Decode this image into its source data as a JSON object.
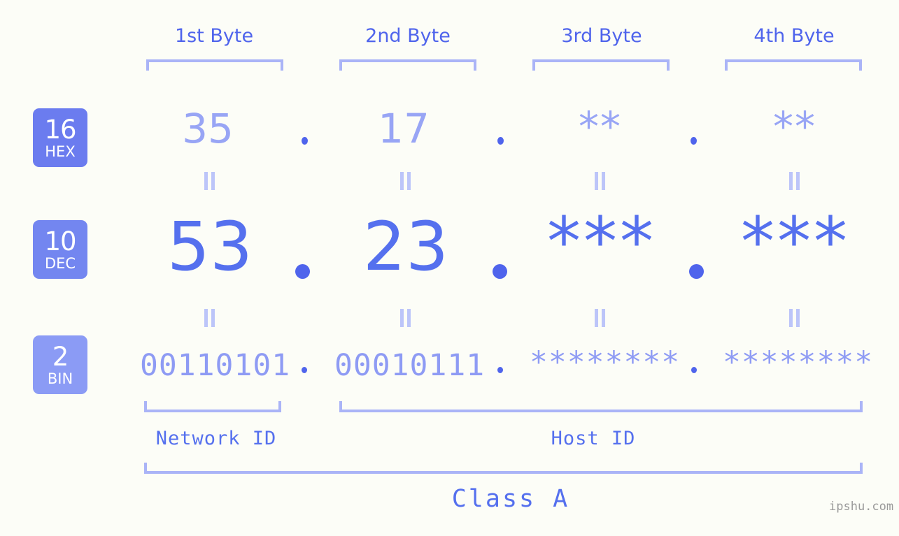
{
  "background_color": "#fcfdf7",
  "accent_color": "#5570ee",
  "muted_color": "#98a5f5",
  "bracket_color": "#aab4f7",
  "headers": [
    {
      "label": "1st Byte"
    },
    {
      "label": "2nd Byte"
    },
    {
      "label": "3rd Byte"
    },
    {
      "label": "4th Byte"
    }
  ],
  "bases": [
    {
      "num": "16",
      "name": "HEX",
      "color": "#6b7cef"
    },
    {
      "num": "10",
      "name": "DEC",
      "color": "#7386f0"
    },
    {
      "num": "2",
      "name": "BIN",
      "color": "#8b9bf5"
    }
  ],
  "rows": {
    "hex": {
      "base_num": "16",
      "base_name": "HEX",
      "values": [
        "35",
        "17",
        "**",
        "**"
      ]
    },
    "dec": {
      "base_num": "10",
      "base_name": "DEC",
      "values": [
        "53",
        "23",
        "***",
        "***"
      ]
    },
    "bin": {
      "base_num": "2",
      "base_name": "BIN",
      "values": [
        "00110101",
        "00010111",
        "********",
        "********"
      ]
    }
  },
  "separator": ".",
  "equals_sign": "=",
  "footer": {
    "network_id_label": "Network ID",
    "host_id_label": "Host ID",
    "class_label": "Class A",
    "watermark": "ipshu.com"
  }
}
